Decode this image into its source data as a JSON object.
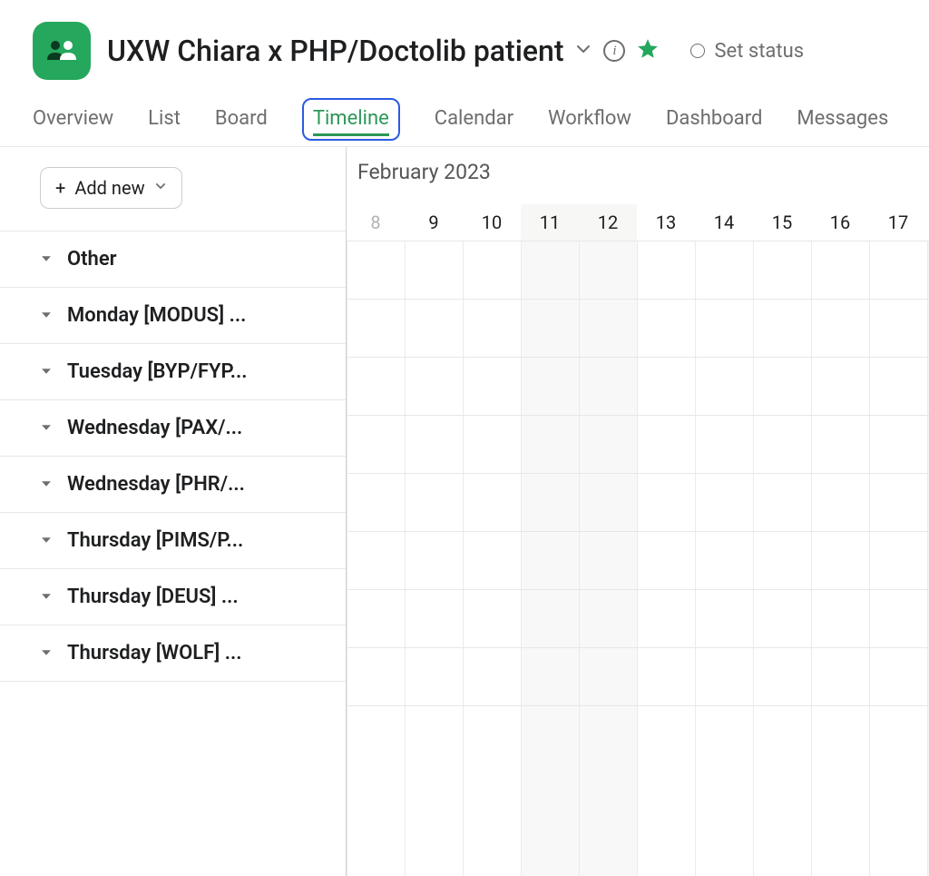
{
  "header": {
    "title": "UXW Chiara x PHP/Doctolib patient",
    "set_status_label": "Set status"
  },
  "tabs": {
    "items": [
      {
        "label": "Overview"
      },
      {
        "label": "List"
      },
      {
        "label": "Board"
      },
      {
        "label": "Timeline",
        "active": true
      },
      {
        "label": "Calendar"
      },
      {
        "label": "Workflow"
      },
      {
        "label": "Dashboard"
      },
      {
        "label": "Messages"
      }
    ]
  },
  "add_new": {
    "label": "Add new"
  },
  "sections": [
    {
      "label": "Other"
    },
    {
      "label": "Monday [MODUS] ..."
    },
    {
      "label": "Tuesday [BYP/FYP..."
    },
    {
      "label": "Wednesday [PAX/..."
    },
    {
      "label": "Wednesday [PHR/..."
    },
    {
      "label": "Thursday [PIMS/P..."
    },
    {
      "label": "Thursday [DEUS] ..."
    },
    {
      "label": "Thursday [WOLF] ..."
    }
  ],
  "timeline": {
    "month_label": "February 2023",
    "days": [
      {
        "num": "8",
        "faded": true,
        "weekend": false
      },
      {
        "num": "9",
        "faded": false,
        "weekend": false
      },
      {
        "num": "10",
        "faded": false,
        "weekend": false
      },
      {
        "num": "11",
        "faded": false,
        "weekend": true
      },
      {
        "num": "12",
        "faded": false,
        "weekend": true
      },
      {
        "num": "13",
        "faded": false,
        "weekend": false
      },
      {
        "num": "14",
        "faded": false,
        "weekend": false
      },
      {
        "num": "15",
        "faded": false,
        "weekend": false
      },
      {
        "num": "16",
        "faded": false,
        "weekend": false
      },
      {
        "num": "17",
        "faded": false,
        "weekend": false
      }
    ]
  }
}
